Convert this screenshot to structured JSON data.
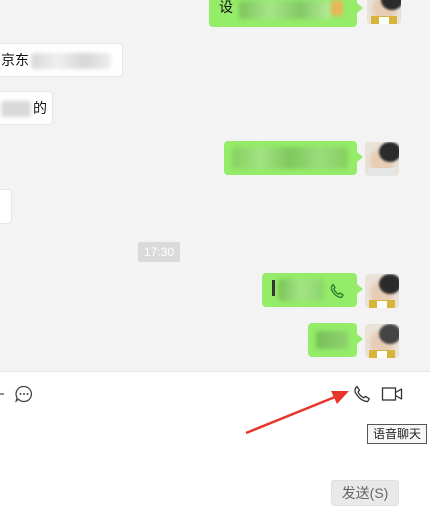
{
  "chat": {
    "messages": [
      {
        "id": "m1",
        "side": "sent",
        "visible_text": "设"
      },
      {
        "id": "m2",
        "side": "recv",
        "visible_text": "京东"
      },
      {
        "id": "m3",
        "side": "recv",
        "visible_text": "的"
      },
      {
        "id": "m4",
        "side": "sent",
        "visible_text": ""
      },
      {
        "id": "m5",
        "side": "recv",
        "visible_text": ""
      },
      {
        "id": "m6",
        "side": "sent",
        "visible_text": "",
        "icon": "phone-icon"
      },
      {
        "id": "m7",
        "side": "sent",
        "visible_text": ""
      }
    ],
    "timestamp": "17:30"
  },
  "toolbar": {
    "left_icons": [
      "scissors-icon",
      "chat-history-icon"
    ],
    "right_icons": [
      "voice-call-icon",
      "video-call-icon"
    ],
    "tooltip": "语音聊天"
  },
  "composer": {
    "send_label": "发送(S)"
  },
  "annotation": {
    "arrow_color": "#e8362d"
  },
  "colors": {
    "sent_bubble": "#95ec69",
    "chat_bg": "#f3f3f3"
  }
}
